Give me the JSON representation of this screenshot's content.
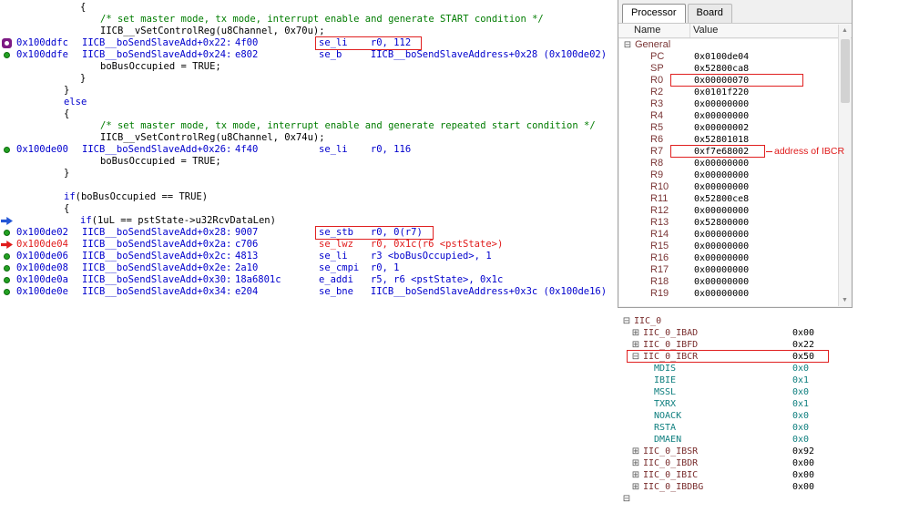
{
  "colors": {
    "asm_blue": "#0000cd",
    "comment_green": "#007c00",
    "highlight_red": "#e01b1b",
    "field_teal": "#0d7e7e",
    "register_maroon": "#7a3535"
  },
  "code": {
    "lines": [
      {
        "kind": "src",
        "indent": 70,
        "segments": [
          {
            "t": "{",
            "c": "p"
          }
        ]
      },
      {
        "kind": "src",
        "indent": 92,
        "segments": [
          {
            "t": "/* set master mode, tx mode, interrupt enable and generate START condition */",
            "c": "c"
          }
        ]
      },
      {
        "kind": "src",
        "indent": 92,
        "segments": [
          {
            "t": "IICB__vSetControlReg(u8Channel, 0x70u);",
            "c": "p"
          }
        ]
      },
      {
        "kind": "asm",
        "gutter": "breakpoint",
        "addr": "0x100ddfc",
        "symbol": "IICB__boSendSlaveAdd+0x22:",
        "opcode": "4f00",
        "instr": "se_li    r0, 112",
        "boxed": true
      },
      {
        "kind": "asm",
        "gutter": "green-dot",
        "addr": "0x100ddfe",
        "symbol": "IICB__boSendSlaveAdd+0x24:",
        "opcode": "e802",
        "instr": "se_b     IICB__boSendSlaveAddress+0x28 (0x100de02)"
      },
      {
        "kind": "src",
        "indent": 92,
        "segments": [
          {
            "t": "boBusOccupied = TRUE;",
            "c": "p"
          }
        ]
      },
      {
        "kind": "src",
        "indent": 70,
        "segments": [
          {
            "t": "}",
            "c": "p"
          }
        ]
      },
      {
        "kind": "src",
        "indent": 52,
        "segments": [
          {
            "t": "}",
            "c": "p"
          }
        ]
      },
      {
        "kind": "src",
        "indent": 52,
        "segments": [
          {
            "t": "else",
            "c": "k"
          }
        ]
      },
      {
        "kind": "src",
        "indent": 52,
        "segments": [
          {
            "t": "{",
            "c": "p"
          }
        ]
      },
      {
        "kind": "src",
        "indent": 92,
        "segments": [
          {
            "t": "/* set master mode, tx mode, interrupt enable and generate repeated start condition */",
            "c": "c"
          }
        ]
      },
      {
        "kind": "src",
        "indent": 92,
        "segments": [
          {
            "t": "IICB__vSetControlReg(u8Channel, 0x74u);",
            "c": "p"
          }
        ]
      },
      {
        "kind": "asm",
        "gutter": "green-dot",
        "addr": "0x100de00",
        "symbol": "IICB__boSendSlaveAdd+0x26:",
        "opcode": "4f40",
        "instr": "se_li    r0, 116"
      },
      {
        "kind": "src",
        "indent": 92,
        "segments": [
          {
            "t": "boBusOccupied = TRUE;",
            "c": "p"
          }
        ]
      },
      {
        "kind": "src",
        "indent": 52,
        "segments": [
          {
            "t": "}",
            "c": "p"
          }
        ]
      },
      {
        "kind": "src",
        "indent": 52,
        "segments": [
          {
            "t": "",
            "c": "p"
          }
        ]
      },
      {
        "kind": "src",
        "indent": 52,
        "segments": [
          {
            "t": "if",
            "c": "k"
          },
          {
            "t": "(boBusOccupied == TRUE)",
            "c": "p"
          }
        ]
      },
      {
        "kind": "src",
        "indent": 52,
        "segments": [
          {
            "t": "{",
            "c": "p"
          }
        ]
      },
      {
        "kind": "src",
        "gutter": "blue-arrow",
        "indent": 70,
        "segments": [
          {
            "t": "if",
            "c": "k"
          },
          {
            "t": "(1uL == pstState->u32RcvDataLen)",
            "c": "p"
          }
        ]
      },
      {
        "kind": "asm",
        "gutter": "green-dot",
        "addr": "0x100de02",
        "symbol": "IICB__boSendSlaveAdd+0x28:",
        "opcode": "9007",
        "instr": "se_stb   r0, 0(r7)",
        "boxed": true
      },
      {
        "kind": "asm",
        "gutter": "pc-marker",
        "addr": "0x100de04",
        "addrRed": true,
        "symbol": "IICB__boSendSlaveAdd+0x2a:",
        "opcode": "c706",
        "instr": "se_lwz   r0, 0x1c(r6 <pstState>)",
        "instrRed": true
      },
      {
        "kind": "asm",
        "gutter": "green-dot",
        "addr": "0x100de06",
        "symbol": "IICB__boSendSlaveAdd+0x2c:",
        "opcode": "4813",
        "instr": "se_li    r3 <boBusOccupied>, 1"
      },
      {
        "kind": "asm",
        "gutter": "green-dot",
        "addr": "0x100de08",
        "symbol": "IICB__boSendSlaveAdd+0x2e:",
        "opcode": "2a10",
        "instr": "se_cmpi  r0, 1"
      },
      {
        "kind": "asm",
        "gutter": "green-dot",
        "addr": "0x100de0a",
        "symbol": "IICB__boSendSlaveAdd+0x30:",
        "opcode": "18a6801c",
        "instr": "e_addi   r5, r6 <pstState>, 0x1c"
      },
      {
        "kind": "asm",
        "gutter": "green-dot",
        "addr": "0x100de0e",
        "symbol": "IICB__boSendSlaveAdd+0x34:",
        "opcode": "e204",
        "instr": "se_bne   IICB__boSendSlaveAddress+0x3c (0x100de16)"
      }
    ]
  },
  "registers_panel": {
    "tabs": [
      {
        "label": "Processor",
        "active": true
      },
      {
        "label": "Board",
        "active": false
      }
    ],
    "columns": [
      "Name",
      "Value"
    ],
    "annotation": "address of IBCR",
    "tree": [
      {
        "level": 0,
        "expand": "minus",
        "name": "General",
        "value": ""
      },
      {
        "level": 1,
        "name": "PC",
        "value": "0x0100de04"
      },
      {
        "level": 1,
        "name": "SP",
        "value": "0x52800ca8"
      },
      {
        "level": 1,
        "name": "R0",
        "value": "0x00000070",
        "boxed": true
      },
      {
        "level": 1,
        "name": "R2",
        "value": "0x0101f220"
      },
      {
        "level": 1,
        "name": "R3",
        "value": "0x00000000"
      },
      {
        "level": 1,
        "name": "R4",
        "value": "0x00000000"
      },
      {
        "level": 1,
        "name": "R5",
        "value": "0x00000002"
      },
      {
        "level": 1,
        "name": "R6",
        "value": "0x52801018"
      },
      {
        "level": 1,
        "name": "R7",
        "value": "0xf7e68002",
        "boxed": true,
        "annotated": true
      },
      {
        "level": 1,
        "name": "R8",
        "value": "0x00000000"
      },
      {
        "level": 1,
        "name": "R9",
        "value": "0x00000000"
      },
      {
        "level": 1,
        "name": "R10",
        "value": "0x00000000"
      },
      {
        "level": 1,
        "name": "R11",
        "value": "0x52800ce8"
      },
      {
        "level": 1,
        "name": "R12",
        "value": "0x00000000"
      },
      {
        "level": 1,
        "name": "R13",
        "value": "0x52800000"
      },
      {
        "level": 1,
        "name": "R14",
        "value": "0x00000000"
      },
      {
        "level": 1,
        "name": "R15",
        "value": "0x00000000"
      },
      {
        "level": 1,
        "name": "R16",
        "value": "0x00000000"
      },
      {
        "level": 1,
        "name": "R17",
        "value": "0x00000000"
      },
      {
        "level": 1,
        "name": "R18",
        "value": "0x00000000"
      },
      {
        "level": 1,
        "name": "R19",
        "value": "0x00000000"
      }
    ]
  },
  "peripherals_panel": {
    "tree": [
      {
        "level": 0,
        "expand": "minus",
        "name": "IIC_0",
        "value": ""
      },
      {
        "level": 1,
        "expand": "plus",
        "name": "IIC_0_IBAD",
        "value": "0x00"
      },
      {
        "level": 1,
        "expand": "plus",
        "name": "IIC_0_IBFD",
        "value": "0x22"
      },
      {
        "level": 1,
        "expand": "minus",
        "name": "IIC_0_IBCR",
        "value": "0x50",
        "boxed": true
      },
      {
        "level": 2,
        "field": true,
        "name": "MDIS",
        "value": "0x0"
      },
      {
        "level": 2,
        "field": true,
        "name": "IBIE",
        "value": "0x1"
      },
      {
        "level": 2,
        "field": true,
        "name": "MSSL",
        "value": "0x0"
      },
      {
        "level": 2,
        "field": true,
        "name": "TXRX",
        "value": "0x1"
      },
      {
        "level": 2,
        "field": true,
        "name": "NOACK",
        "value": "0x0"
      },
      {
        "level": 2,
        "field": true,
        "name": "RSTA",
        "value": "0x0"
      },
      {
        "level": 2,
        "field": true,
        "name": "DMAEN",
        "value": "0x0"
      },
      {
        "level": 1,
        "expand": "plus",
        "name": "IIC_0_IBSR",
        "value": "0x92"
      },
      {
        "level": 1,
        "expand": "plus",
        "name": "IIC_0_IBDR",
        "value": "0x00"
      },
      {
        "level": 1,
        "expand": "plus",
        "name": "IIC_0_IBIC",
        "value": "0x00"
      },
      {
        "level": 1,
        "expand": "plus",
        "name": "IIC_0_IBDBG",
        "value": "0x00"
      },
      {
        "level": 0,
        "expand": "minus",
        "name": "",
        "value": "",
        "partial": true
      }
    ]
  }
}
